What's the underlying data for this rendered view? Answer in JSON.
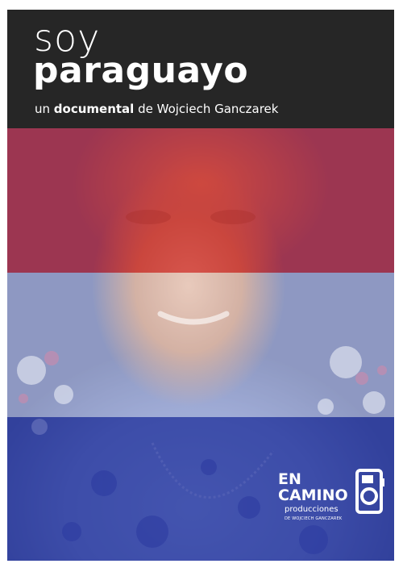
{
  "header": {
    "title_small": "soy",
    "title_main": "paraguayo",
    "subtitle_prefix": "un",
    "subtitle_bold": "documental",
    "subtitle_suffix": "de Wojciech Ganczarek"
  },
  "logo": {
    "line1": "EN",
    "line2": "CAMINO",
    "line3": "producciones",
    "line4": "DE WOJCIECH GANCZAREK"
  },
  "colors": {
    "header_bg": "#262626",
    "flag_red": "#d62626",
    "flag_white": "#ffffff",
    "flag_blue": "#2c38a0"
  }
}
